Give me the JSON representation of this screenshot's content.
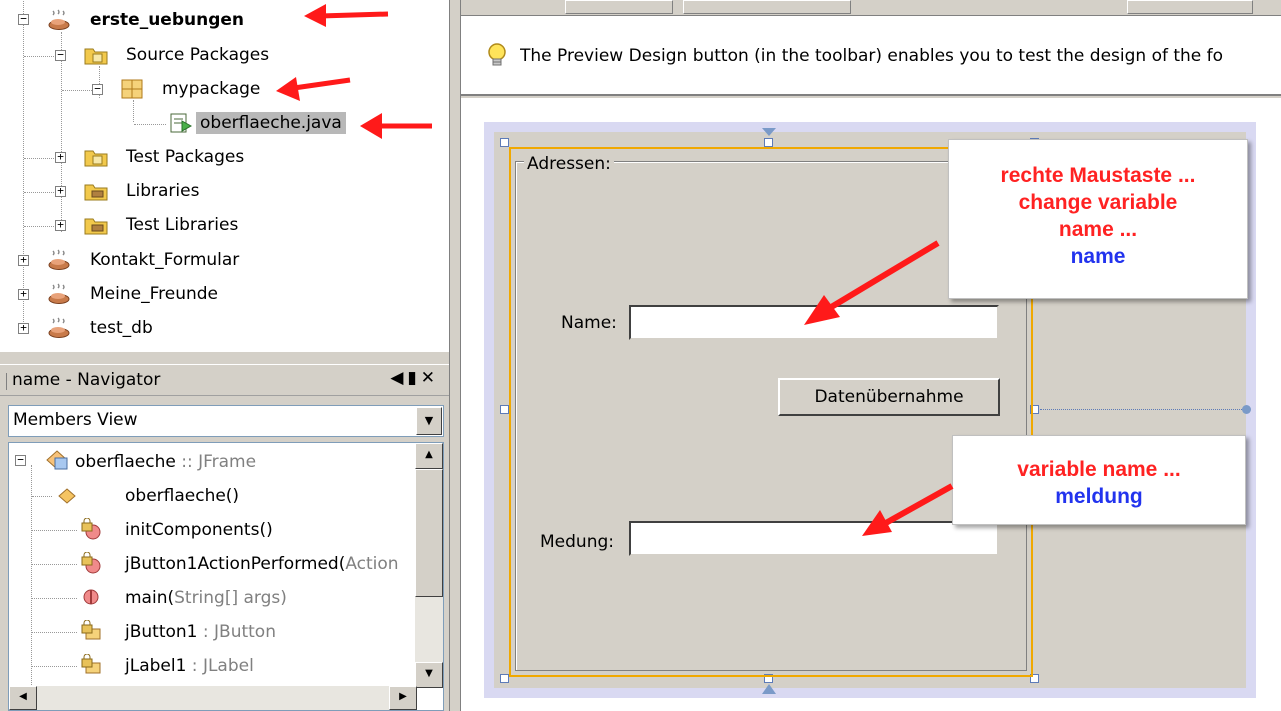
{
  "tree": {
    "project": "erste_uebungen",
    "source_packages": "Source Packages",
    "package": "mypackage",
    "file": "oberflaeche.java",
    "test_packages": "Test Packages",
    "libraries": "Libraries",
    "test_libraries": "Test Libraries",
    "other_projects": [
      "Kontakt_Formular",
      "Meine_Freunde",
      "test_db"
    ]
  },
  "navigator": {
    "title": "name - Navigator",
    "view_select": "Members View",
    "members": [
      {
        "name": "oberflaeche",
        "type": " :: JFrame"
      },
      {
        "name": "oberflaeche()",
        "type": ""
      },
      {
        "name": "initComponents()",
        "type": ""
      },
      {
        "name": "jButton1ActionPerformed(",
        "type": "Action"
      },
      {
        "name": "main(",
        "type": "String[] args)"
      },
      {
        "name": "jButton1",
        "type": " : JButton"
      },
      {
        "name": "jLabel1",
        "type": " : JLabel"
      }
    ]
  },
  "hint": "The Preview Design button (in the toolbar) enables you to test the design of the fo",
  "form": {
    "border_title": "Adressen:",
    "name_label": "Name:",
    "button_label": "Datenübernahme",
    "meldung_label": "Medung:",
    "name_value": "",
    "meldung_value": ""
  },
  "callouts": {
    "first": {
      "line1": "rechte Maustaste ...",
      "line2": "change variable",
      "line3": "name ...",
      "line4": "name"
    },
    "second": {
      "line1": "variable name ...",
      "line2": "meldung"
    }
  },
  "colors": {
    "annotation_red": "#ff2222",
    "annotation_blue": "#2233ee",
    "selection_orange": "#f0a800"
  },
  "icons": {
    "project": "coffee-cup-icon",
    "folder": "package-folder-icon",
    "package": "package-icon",
    "java_file": "java-form-file-icon",
    "library": "library-folder-icon"
  }
}
